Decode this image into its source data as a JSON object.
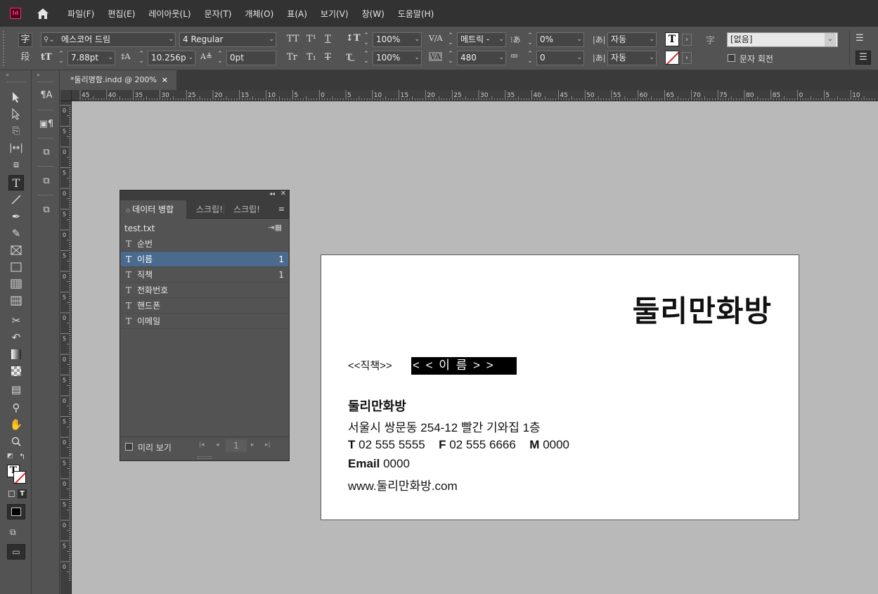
{
  "app": {
    "logo": "Id"
  },
  "menu": [
    "파일(F)",
    "편집(E)",
    "레이아웃(L)",
    "문자(T)",
    "개체(O)",
    "표(A)",
    "보기(V)",
    "창(W)",
    "도움말(H)"
  ],
  "control": {
    "char_mode": "字",
    "para_mode": "段",
    "font_family": "에스코어 드림",
    "font_style": "4 Regular",
    "font_size": "7.88pt",
    "leading": "10.256p",
    "baseline_shift": "0pt",
    "vertical_scale": "100%",
    "horizontal_scale": "100%",
    "kerning": "메트릭 -",
    "tracking": "480",
    "tsume": "0%",
    "mojikumi": "0",
    "aki_before": "자동",
    "aki_after": "자동",
    "char_style": "[없음]",
    "rotate_label": "문자 회전",
    "tt_labels": [
      "TT",
      "T¹",
      "T",
      "Tr",
      "T₁",
      "T"
    ]
  },
  "document_tab": {
    "title": "*둘리명함.indd @ 200%",
    "close": "×"
  },
  "ruler": {
    "h_ticks": [
      "45",
      "40",
      "35",
      "30",
      "25",
      "20",
      "15",
      "10",
      "5",
      "0",
      "5",
      "10",
      "15",
      "20",
      "25",
      "30",
      "35",
      "40",
      "45",
      "50",
      "55",
      "60",
      "65",
      "70",
      "75",
      "80",
      "85",
      "0",
      "5",
      "10"
    ],
    "v_ticks": [
      "0",
      "5",
      "0",
      "5",
      "0",
      "5",
      "0",
      "5",
      "0",
      "5",
      "0",
      "5",
      "0",
      "5",
      "0",
      "5",
      "0",
      "5",
      "0",
      "5",
      "0",
      "5",
      "0"
    ]
  },
  "data_merge": {
    "tabs": [
      "데이터 병합",
      "스크립!",
      "스크립!"
    ],
    "source": "test.txt",
    "fields": [
      {
        "name": "순번",
        "count": ""
      },
      {
        "name": "이름",
        "count": "1"
      },
      {
        "name": "직책",
        "count": "1"
      },
      {
        "name": "전화번호",
        "count": ""
      },
      {
        "name": "핸드폰",
        "count": ""
      },
      {
        "name": "이메일",
        "count": ""
      }
    ],
    "selected_index": 1,
    "preview_label": "미리 보기",
    "record": "1"
  },
  "card": {
    "brand": "둘리만화방",
    "title_field": "<<직책>>",
    "name_field": "< < 이 름 > >",
    "company": "둘리만화방",
    "address": "서울시 쌍문동 254-12 빨간 기와집 1층",
    "phone_label": "T",
    "phone": "02 555 5555",
    "fax_label": "F",
    "fax": "02 555 6666",
    "mobile_label": "M",
    "mobile": "0000",
    "email_label": "Email",
    "email": "0000",
    "website": "www.둘리만화방.com"
  }
}
